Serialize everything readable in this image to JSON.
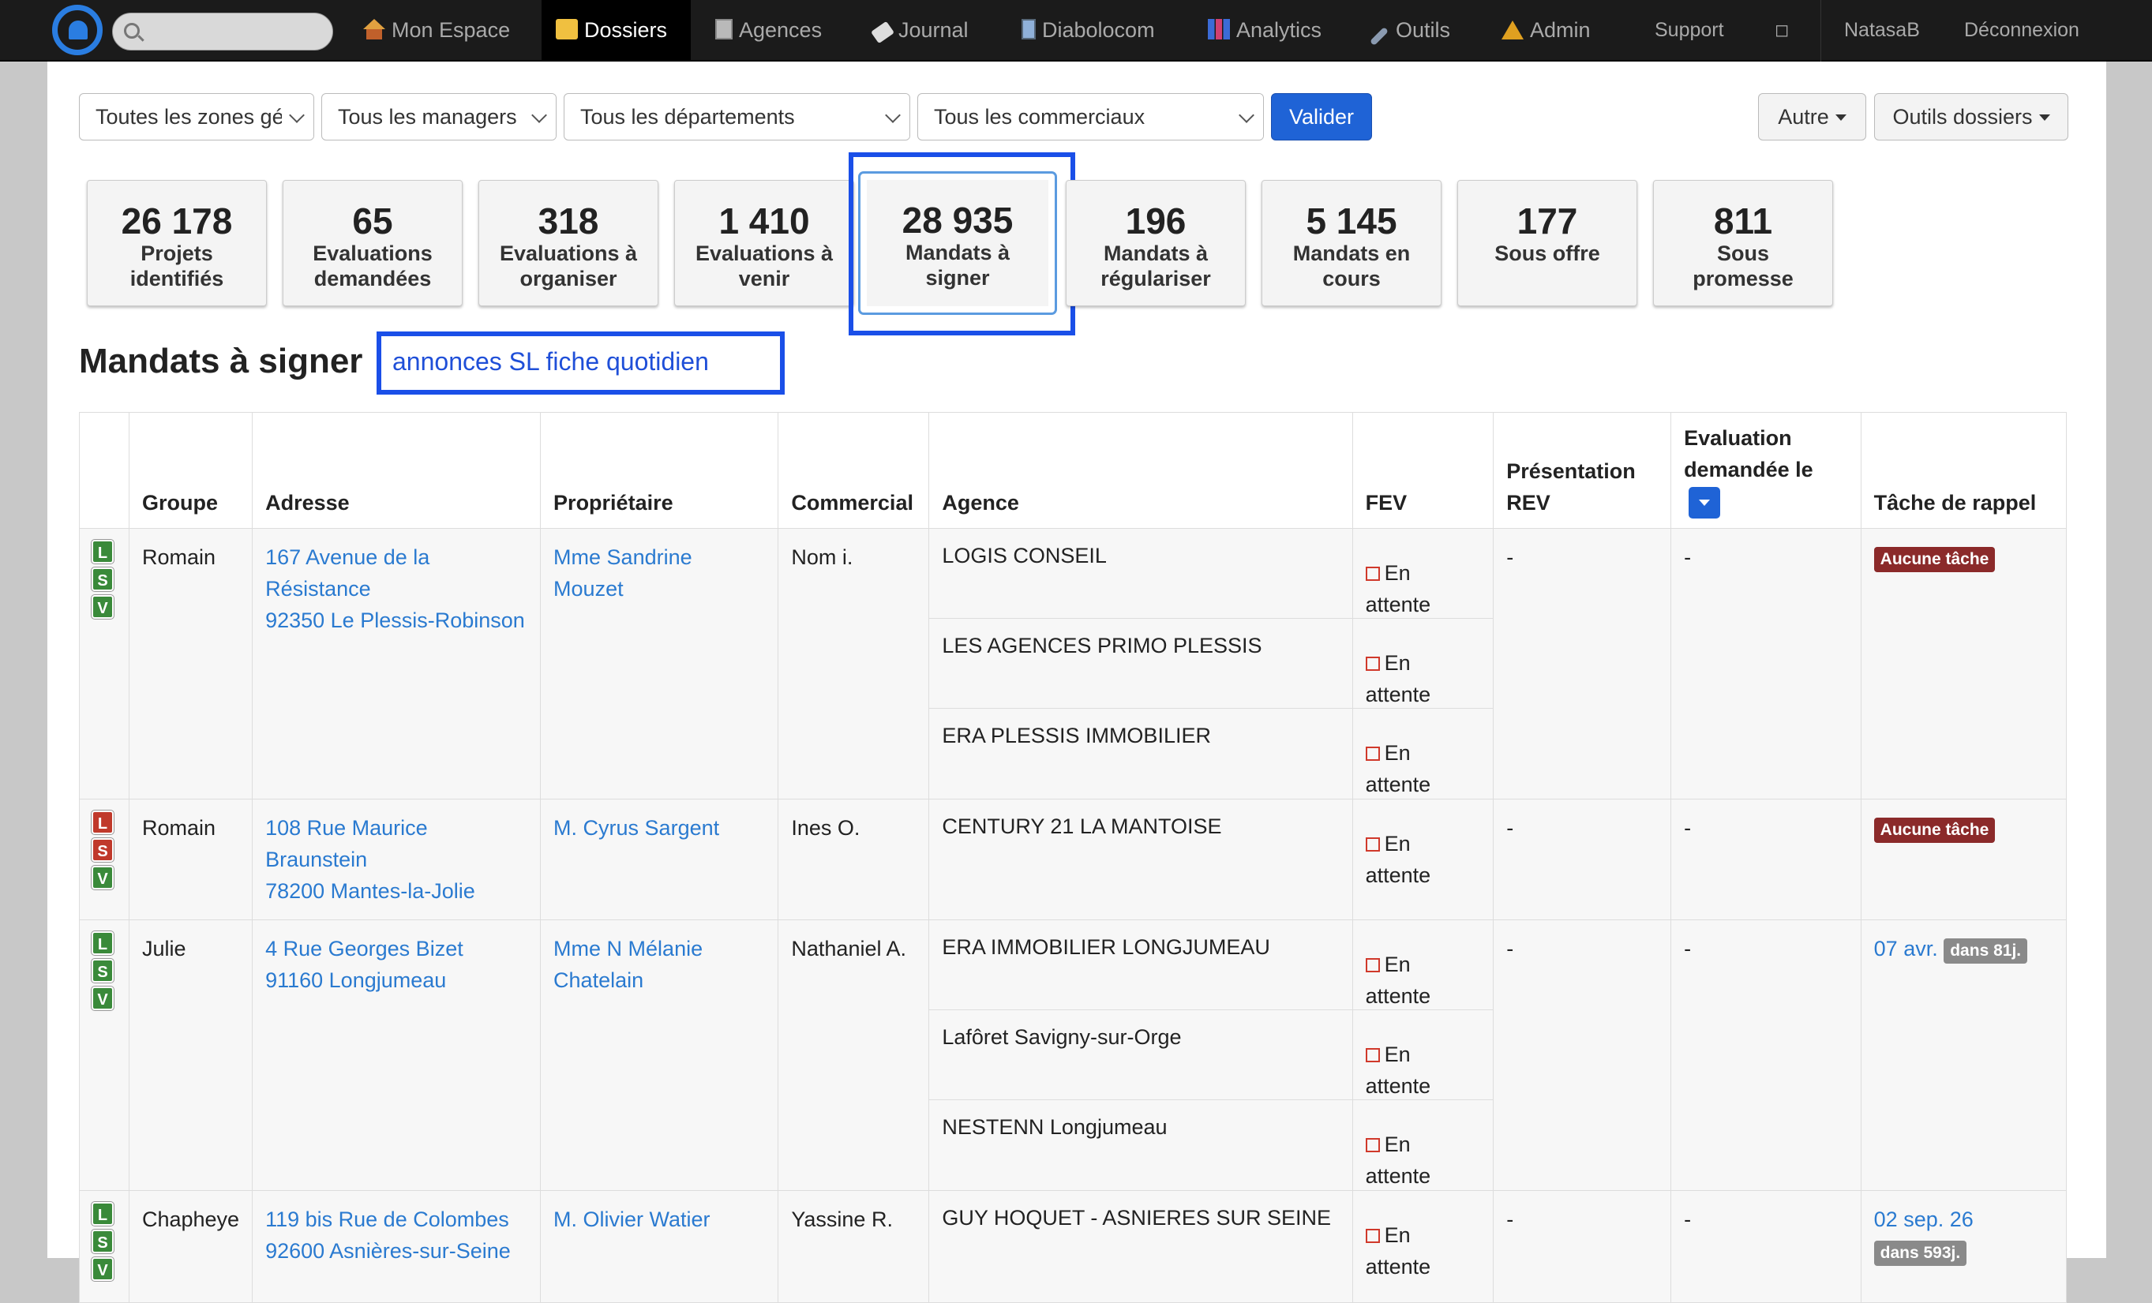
{
  "nav": {
    "search_placeholder": "",
    "items": [
      {
        "label": "Mon Espace",
        "icon": "house-icon"
      },
      {
        "label": "Dossiers",
        "icon": "folder-icon"
      },
      {
        "label": "Agences",
        "icon": "building-icon"
      },
      {
        "label": "Journal",
        "icon": "tag-icon"
      },
      {
        "label": "Diabolocom",
        "icon": "phone-icon"
      },
      {
        "label": "Analytics",
        "icon": "chart-icon"
      },
      {
        "label": "Outils",
        "icon": "wrench-icon"
      },
      {
        "label": "Admin",
        "icon": "warning-icon"
      }
    ],
    "support": "Support",
    "square": "◻",
    "user": "NatasaB",
    "logout": "Déconnexion"
  },
  "filters": {
    "zones": "Toutes les zones géo",
    "managers": "Tous les managers",
    "departements": "Tous les départements",
    "commerciaux": "Tous les commerciaux",
    "valider": "Valider",
    "autre": "Autre",
    "outils": "Outils dossiers"
  },
  "stats": [
    {
      "num": "26 178",
      "l1": "Projets",
      "l2": "identifiés"
    },
    {
      "num": "65",
      "l1": "Evaluations",
      "l2": "demandées"
    },
    {
      "num": "318",
      "l1": "Evaluations à",
      "l2": "organiser"
    },
    {
      "num": "1 410",
      "l1": "Evaluations à",
      "l2": "venir"
    },
    {
      "num": "28 935",
      "l1": "Mandats à",
      "l2": "signer"
    },
    {
      "num": "196",
      "l1": "Mandats à",
      "l2": "régulariser"
    },
    {
      "num": "5 145",
      "l1": "Mandats en",
      "l2": "cours"
    },
    {
      "num": "177",
      "l1": "Sous offre",
      "l2": ""
    },
    {
      "num": "811",
      "l1": "Sous",
      "l2": "promesse"
    }
  ],
  "section": {
    "title": "Mandats à signer",
    "link": "annonces SL fiche quotidien"
  },
  "table": {
    "headers": {
      "groupe": "Groupe",
      "adresse": "Adresse",
      "proprietaire": "Propriétaire",
      "commercial": "Commercial",
      "agence": "Agence",
      "fev": "FEV",
      "presentation_1": "Présentation",
      "presentation_2": "REV",
      "evaluation_1": "Evaluation",
      "evaluation_2": "demandée le",
      "tache": "Tâche de rappel"
    },
    "lsv": [
      "L",
      "S",
      "V"
    ],
    "fev_status": "En attente",
    "rows": [
      {
        "groupe": "Romain",
        "adresse1": "167 Avenue de la",
        "adresse2": "Résistance",
        "adresse3": "92350 Le Plessis-Robinson",
        "proprietaire1": "Mme Sandrine Mouzet",
        "proprietaire2": "",
        "commercial": "Nom i.",
        "agences": [
          "LOGIS CONSEIL",
          "LES AGENCES PRIMO PLESSIS",
          "ERA PLESSIS IMMOBILIER"
        ],
        "presentation": "-",
        "evaluation": "-",
        "tache": "Aucune tâche"
      },
      {
        "groupe": "Romain",
        "adresse1": "108 Rue Maurice Braunstein",
        "adresse2": "78200 Mantes-la-Jolie",
        "adresse3": "",
        "proprietaire1": "M. Cyrus Sargent",
        "proprietaire2": "",
        "commercial": "Ines O.",
        "agences": [
          "CENTURY 21 LA MANTOISE"
        ],
        "presentation": "-",
        "evaluation": "-",
        "tache": "Aucune tâche"
      },
      {
        "groupe": "Julie",
        "adresse1": "4 Rue Georges Bizet",
        "adresse2": "91160 Longjumeau",
        "adresse3": "",
        "proprietaire1": "Mme N Mélanie",
        "proprietaire2": "Chatelain",
        "commercial": "Nathaniel A.",
        "agences": [
          "ERA IMMOBILIER LONGJUMEAU",
          "Lafôret Savigny-sur-Orge",
          "NESTENN Longjumeau"
        ],
        "presentation": "-",
        "evaluation": "-",
        "tache_date": "07 avr.",
        "tache_badge": "dans 81j."
      },
      {
        "groupe": "Chapheye",
        "adresse1": "119 bis Rue de Colombes",
        "adresse2": "92600 Asnières-sur-Seine",
        "adresse3": "",
        "proprietaire1": "M. Olivier Watier",
        "proprietaire2": "",
        "commercial": "Yassine R.",
        "agences": [
          "GUY HOQUET - ASNIERES SUR SEINE"
        ],
        "presentation": "-",
        "evaluation": "-",
        "tache_date": "02 sep. 26",
        "tache_badge": "dans 593j."
      }
    ]
  }
}
